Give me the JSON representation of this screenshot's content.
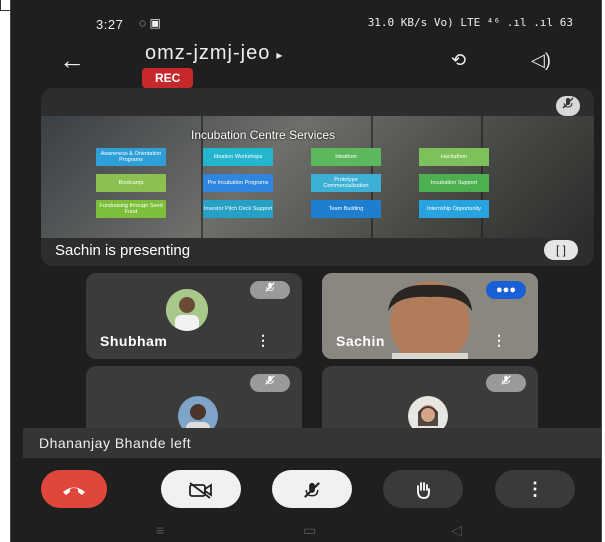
{
  "status_bar": {
    "time": "3:27",
    "left_icons": "◌ ▣",
    "right_icons": "31.0 KB/s  Vo) LTE  ⁴⁶ .ıl .ıl  63"
  },
  "header": {
    "back_icon": "←",
    "meeting_code": "omz-jzmj-jeo",
    "play_icon": "▸",
    "rec_label": "REC",
    "switch_camera_icon": "⟲",
    "speaker_icon": "◁)"
  },
  "presentation": {
    "slide_title": "Incubation Centre Services",
    "tiles": [
      {
        "label": "Awareness & Orientation Programs",
        "color": "#2f9fd8"
      },
      {
        "label": "Ideation Workshops",
        "color": "#25b6cf"
      },
      {
        "label": "Ideathon",
        "color": "#5cb85c"
      },
      {
        "label": "Hackathon",
        "color": "#7cc15a"
      },
      {
        "label": "Bootcamp",
        "color": "#8cc152"
      },
      {
        "label": "Pre Incubation Programs",
        "color": "#2e86de"
      },
      {
        "label": "Prototype Commercialization",
        "color": "#3db0d6"
      },
      {
        "label": "Incubation Support",
        "color": "#4caf50"
      },
      {
        "label": "Fundraising through Seed Fund",
        "color": "#7bbf3a"
      },
      {
        "label": "Investor Pitch Deck Support",
        "color": "#26a0c4"
      },
      {
        "label": "Team Building",
        "color": "#1e7fd1"
      },
      {
        "label": "Internship Opportunity",
        "color": "#27a4e0"
      }
    ],
    "presenting_text": "Sachin is presenting",
    "mic_icon": "mic-off",
    "expand_icon": "[ ]"
  },
  "participants": [
    {
      "name": "Shubham",
      "muted": true
    },
    {
      "name": "Sachin",
      "speaking": true
    },
    {
      "name": "",
      "muted": true
    },
    {
      "name": "",
      "muted": true
    }
  ],
  "toast": "Dhananjay Bhande left",
  "controls": {
    "end_call_icon": "☎",
    "camera_off_icon": "▭",
    "mic_off_icon": "🎙",
    "raise_hand_icon": "✋",
    "more_icon": "⋮",
    "colors": {
      "end": "#e0473c",
      "light": "#f1f1f1",
      "dark": "#3a3a3a"
    }
  },
  "nav_bar": {
    "menu_icon": "≡",
    "home_icon": "▭",
    "back_icon": "◁"
  }
}
